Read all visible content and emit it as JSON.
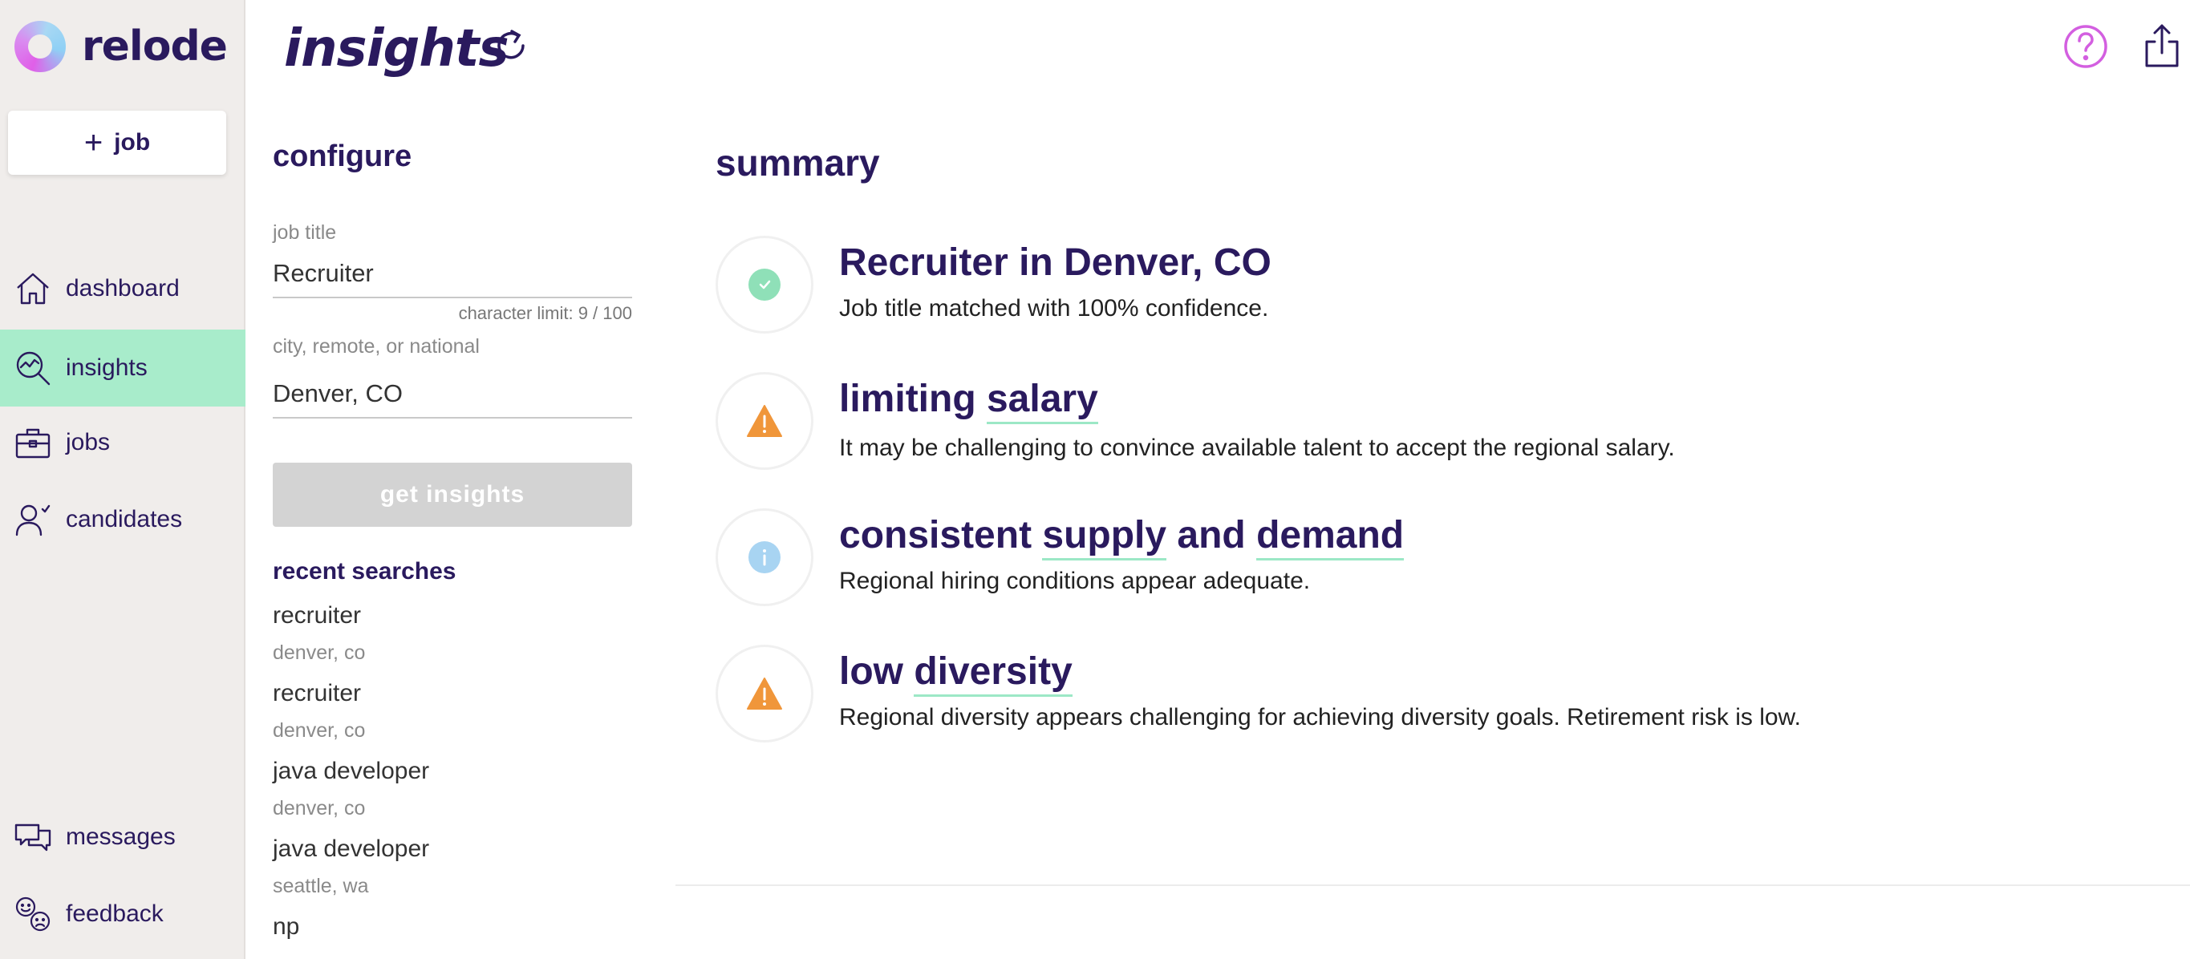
{
  "app": {
    "name": "relode"
  },
  "sidebar": {
    "add_job_label": "job",
    "items": [
      {
        "label": "dashboard",
        "icon": "home-icon"
      },
      {
        "label": "insights",
        "icon": "insights-icon",
        "active": true
      },
      {
        "label": "jobs",
        "icon": "briefcase-icon"
      },
      {
        "label": "candidates",
        "icon": "candidate-icon"
      }
    ],
    "bottom_items": [
      {
        "label": "messages",
        "icon": "messages-icon"
      },
      {
        "label": "feedback",
        "icon": "feedback-icon"
      }
    ]
  },
  "header": {
    "title": "insights"
  },
  "configure": {
    "title": "configure",
    "job_title_label": "job title",
    "job_title_value": "Recruiter",
    "char_limit": "character limit: 9 / 100",
    "location_label": "city, remote, or national",
    "location_value": "Denver, CO",
    "button_label": "get insights",
    "recent_title": "recent searches",
    "recent": [
      {
        "job": "recruiter",
        "location": "denver, co"
      },
      {
        "job": "recruiter",
        "location": "denver, co"
      },
      {
        "job": "java developer",
        "location": "denver, co"
      },
      {
        "job": "java developer",
        "location": "seattle, wa"
      },
      {
        "job": "np",
        "location": ""
      }
    ]
  },
  "summary": {
    "title": "summary",
    "rows": [
      {
        "status": "success",
        "heading": "Recruiter in Denver, CO",
        "description": "Job title matched with 100% confidence."
      },
      {
        "status": "warning",
        "heading_plain": "limiting ",
        "heading_underlined": "salary",
        "description": "It may be challenging to convince available talent to accept the regional salary."
      },
      {
        "status": "info",
        "heading_a": "consistent ",
        "heading_b": "supply",
        "heading_c": " and ",
        "heading_d": "demand",
        "description": "Regional hiring conditions appear adequate."
      },
      {
        "status": "warning",
        "heading_plain": "low ",
        "heading_underlined": "diversity",
        "description": "Regional diversity appears challenging for achieving diversity goals. Retirement risk is low."
      }
    ]
  },
  "colors": {
    "brand": "#2a1a5e",
    "active_nav": "#a8eccb",
    "success": "#8fe0b8",
    "warning": "#f0963a",
    "info": "#a8d4f2",
    "help": "#d35fe0"
  }
}
